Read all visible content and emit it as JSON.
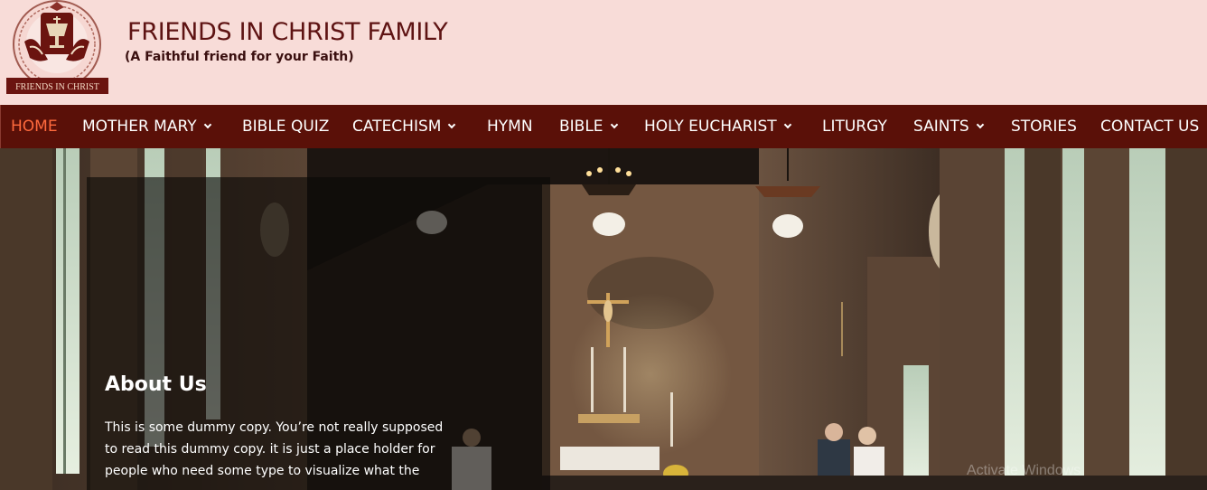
{
  "header": {
    "logo_text": "FRIENDS IN CHRIST",
    "site_title": "FRIENDS IN CHRIST FAMILY",
    "tagline": "(A Faithful friend for your Faith)"
  },
  "nav": {
    "items": [
      {
        "label": "HOME",
        "active": true,
        "dropdown": false
      },
      {
        "label": "MOTHER MARY",
        "active": false,
        "dropdown": true
      },
      {
        "label": "BIBLE QUIZ",
        "active": false,
        "dropdown": false
      },
      {
        "label": "CATECHISM",
        "active": false,
        "dropdown": true
      },
      {
        "label": "HYMN",
        "active": false,
        "dropdown": false
      },
      {
        "label": "BIBLE",
        "active": false,
        "dropdown": true
      },
      {
        "label": "HOLY EUCHARIST",
        "active": false,
        "dropdown": true
      },
      {
        "label": "LITURGY",
        "active": false,
        "dropdown": false
      },
      {
        "label": "SAINTS",
        "active": false,
        "dropdown": true
      },
      {
        "label": "STORIES",
        "active": false,
        "dropdown": false
      },
      {
        "label": "CONTACT US",
        "active": false,
        "dropdown": false
      }
    ]
  },
  "about": {
    "title": "About Us",
    "lines": [
      "This is some dummy copy. You’re not really supposed",
      "to read this dummy copy. it is just a place holder for",
      "people who need some type to visualize what the"
    ]
  },
  "watermark": "Activate Windows",
  "colors": {
    "header_bg": "#f8dcd8",
    "nav_bg": "#5a1008",
    "nav_active": "#ff6a3d",
    "title": "#5e1313"
  },
  "icons": {
    "logo": "chalice-praying-hands-logo",
    "dropdown": "chevron-down-icon"
  }
}
